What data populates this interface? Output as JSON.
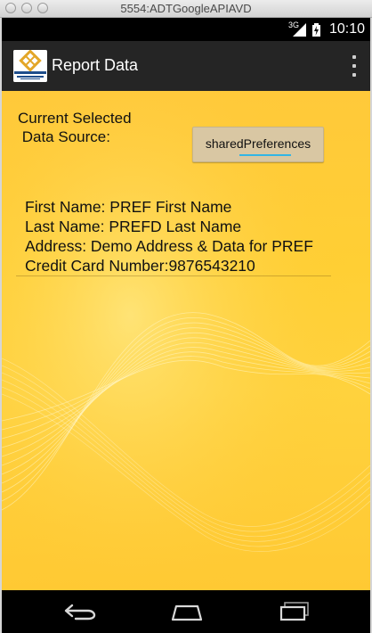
{
  "window": {
    "title": "5554:ADTGoogleAPIAVD"
  },
  "status_bar": {
    "network": "3G",
    "time": "10:10"
  },
  "action_bar": {
    "title": "Report Data"
  },
  "main": {
    "current_label_line1": "Current Selected",
    "current_label_line2": " Data Source:",
    "data_source_button": "sharedPreferences",
    "first_name": "First Name: PREF First Name",
    "last_name": "Last Name: PREFD Last Name",
    "address": "Address: Demo Address & Data for PREF",
    "credit_card": "Credit Card Number:9876543210"
  },
  "icons": {
    "signal": "signal-icon",
    "battery": "battery-icon",
    "overflow": "overflow-menu-icon",
    "back": "back-icon",
    "home": "home-icon",
    "recents": "recent-apps-icon",
    "logo": "university-logo"
  },
  "colors": {
    "accent": "#33b5e5",
    "action_bar": "#252525",
    "background": "#ffcf34"
  }
}
